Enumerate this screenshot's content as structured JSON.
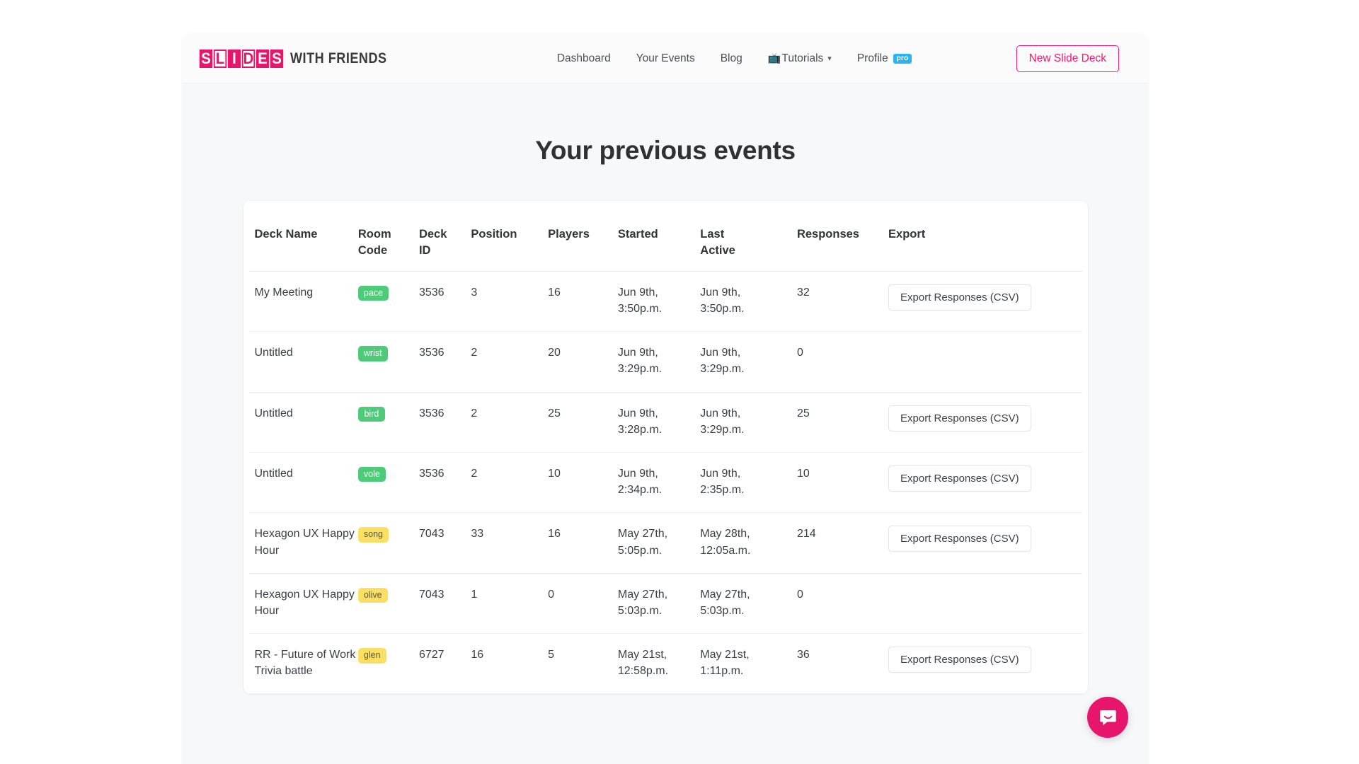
{
  "colors": {
    "brand_pink": "#e8156d",
    "cta_pink": "#f5146e",
    "pro_blue": "#27b5f5",
    "badge_green": "#4ecb79",
    "badge_yellow": "#fbdf62",
    "page_bg": "#f7f8fa"
  },
  "navbar": {
    "logo": {
      "blocks": [
        {
          "char": "S",
          "style": "fill"
        },
        {
          "char": "L",
          "style": "hollow"
        },
        {
          "char": "I",
          "style": "fill"
        },
        {
          "char": "D",
          "style": "hollow"
        },
        {
          "char": "E",
          "style": "fill"
        },
        {
          "char": "S",
          "style": "fill"
        }
      ],
      "word": "WITH FRIENDS",
      "full_text": "SLIDES WITH FRIENDS"
    },
    "links": [
      {
        "label": "Dashboard",
        "name": "nav-link-dashboard"
      },
      {
        "label": "Your Events",
        "name": "nav-link-your-events"
      },
      {
        "label": "Blog",
        "name": "nav-link-blog"
      }
    ],
    "tutorials": {
      "icon": "tv-icon",
      "icon_glyph": "📺",
      "label": "Tutorials",
      "caret": "▾"
    },
    "profile": {
      "label": "Profile",
      "badge": "pro"
    },
    "cta": {
      "label": "New Slide Deck"
    }
  },
  "main": {
    "title": "Your previous events"
  },
  "table": {
    "headers": [
      "Deck Name",
      "Room\nCode",
      "Deck\nID",
      "Position",
      "Players",
      "Started",
      "Last\nActive",
      "Responses",
      "Export"
    ],
    "export_label": "Export Responses (CSV)",
    "rows": [
      {
        "deck_name": "My Meeting",
        "room_code": "pace",
        "room_code_color": "green",
        "deck_id": "3536",
        "position": "3",
        "players": "16",
        "started": "Jun 9th,\n3:50p.m.",
        "last_active": "Jun 9th,\n3:50p.m.",
        "responses": "32",
        "has_export": true
      },
      {
        "deck_name": "Untitled",
        "room_code": "wrist",
        "room_code_color": "green",
        "deck_id": "3536",
        "position": "2",
        "players": "20",
        "started": "Jun 9th,\n3:29p.m.",
        "last_active": "Jun 9th,\n3:29p.m.",
        "responses": "0",
        "has_export": false
      },
      {
        "deck_name": "Untitled",
        "room_code": "bird",
        "room_code_color": "green",
        "deck_id": "3536",
        "position": "2",
        "players": "25",
        "started": "Jun 9th,\n3:28p.m.",
        "last_active": "Jun 9th,\n3:29p.m.",
        "responses": "25",
        "has_export": true
      },
      {
        "deck_name": "Untitled",
        "room_code": "vole",
        "room_code_color": "green",
        "deck_id": "3536",
        "position": "2",
        "players": "10",
        "started": "Jun 9th,\n2:34p.m.",
        "last_active": "Jun 9th,\n2:35p.m.",
        "responses": "10",
        "has_export": true
      },
      {
        "deck_name": "Hexagon UX Happy Hour",
        "room_code": "song",
        "room_code_color": "yellow",
        "deck_id": "7043",
        "position": "33",
        "players": "16",
        "started": "May 27th,\n5:05p.m.",
        "last_active": "May 28th,\n12:05a.m.",
        "responses": "214",
        "has_export": true
      },
      {
        "deck_name": "Hexagon UX Happy Hour",
        "room_code": "olive",
        "room_code_color": "yellow",
        "deck_id": "7043",
        "position": "1",
        "players": "0",
        "started": "May 27th,\n5:03p.m.",
        "last_active": "May 27th,\n5:03p.m.",
        "responses": "0",
        "has_export": false
      },
      {
        "deck_name": "RR - Future of Work Trivia battle",
        "room_code": "glen",
        "room_code_color": "yellow",
        "deck_id": "6727",
        "position": "16",
        "players": "5",
        "started": "May 21st,\n12:58p.m.",
        "last_active": "May 21st,\n1:11p.m.",
        "responses": "36",
        "has_export": true
      }
    ]
  },
  "intercom": {
    "icon": "chat-bubble-smile-icon"
  }
}
